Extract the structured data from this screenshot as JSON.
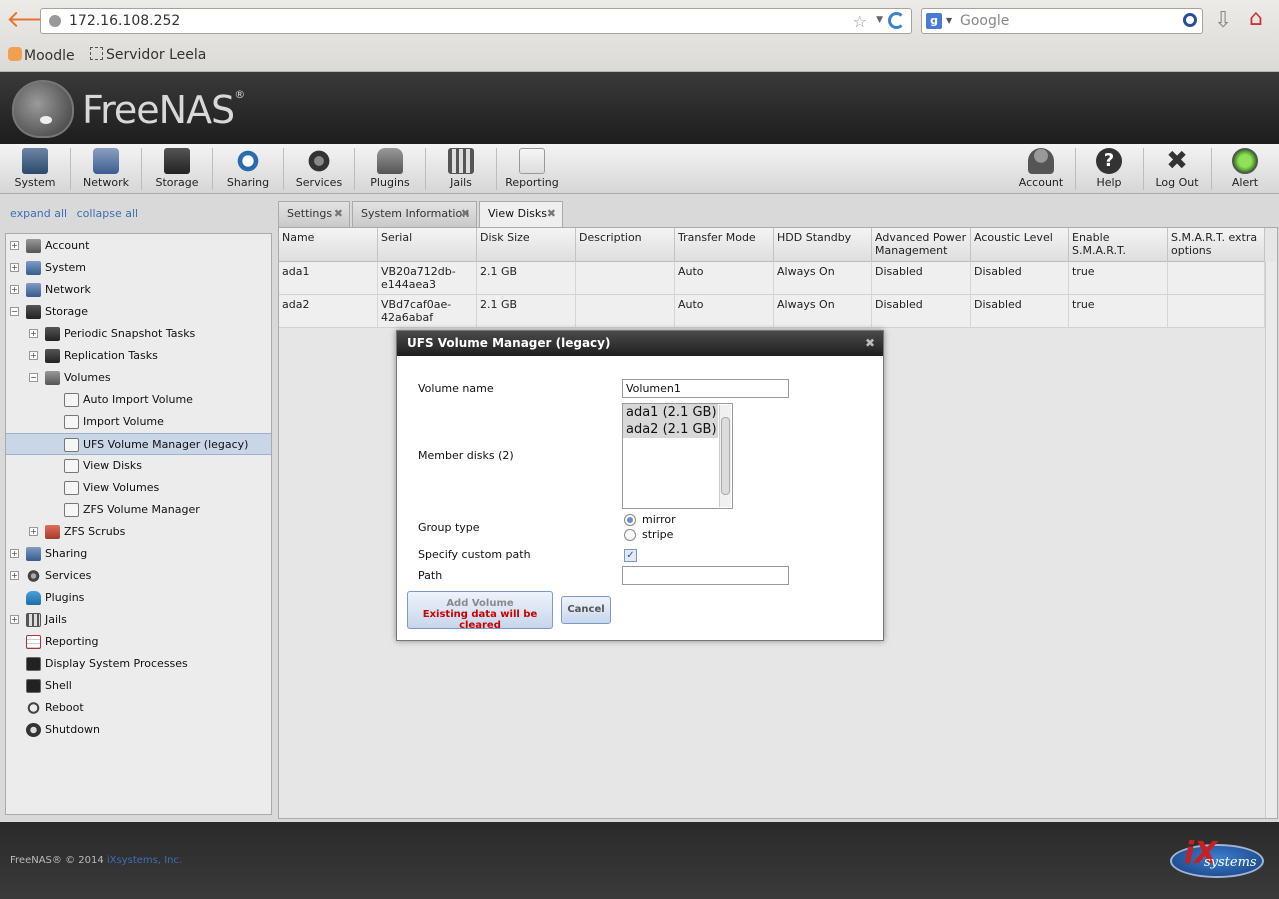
{
  "browser": {
    "url": "172.16.108.252",
    "search_placeholder": "Google",
    "bookmarks": [
      "Moodle",
      "Servidor Leela"
    ]
  },
  "brand": {
    "name": "FreeNAS",
    "reg": "®"
  },
  "toolbar": {
    "left": [
      {
        "label": "System",
        "icon": "system-icon"
      },
      {
        "label": "Network",
        "icon": "network-icon"
      },
      {
        "label": "Storage",
        "icon": "storage-icon"
      },
      {
        "label": "Sharing",
        "icon": "sharing-icon"
      },
      {
        "label": "Services",
        "icon": "services-icon"
      },
      {
        "label": "Plugins",
        "icon": "plugins-icon"
      },
      {
        "label": "Jails",
        "icon": "jails-icon"
      },
      {
        "label": "Reporting",
        "icon": "reporting-icon"
      }
    ],
    "right": [
      {
        "label": "Account",
        "icon": "account-icon"
      },
      {
        "label": "Help",
        "icon": "help-icon"
      },
      {
        "label": "Log Out",
        "icon": "logout-icon"
      },
      {
        "label": "Alert",
        "icon": "alert-icon"
      }
    ]
  },
  "sidebar": {
    "expand_all": "expand all",
    "collapse_all": "collapse all",
    "items": {
      "account": "Account",
      "system": "System",
      "network": "Network",
      "storage": "Storage",
      "periodic_snapshot": "Periodic Snapshot Tasks",
      "replication": "Replication Tasks",
      "volumes": "Volumes",
      "auto_import": "Auto Import Volume",
      "import_volume": "Import Volume",
      "ufs_manager": "UFS Volume Manager (legacy)",
      "view_disks": "View Disks",
      "view_volumes": "View Volumes",
      "zfs_manager": "ZFS Volume Manager",
      "zfs_scrubs": "ZFS Scrubs",
      "sharing": "Sharing",
      "services": "Services",
      "plugins": "Plugins",
      "jails": "Jails",
      "reporting": "Reporting",
      "processes": "Display System Processes",
      "shell": "Shell",
      "reboot": "Reboot",
      "shutdown": "Shutdown"
    }
  },
  "tabs": {
    "settings": "Settings",
    "system_info": "System Information",
    "view_disks": "View Disks",
    "close_glyph": "✖"
  },
  "grid": {
    "columns": [
      "Name",
      "Serial",
      "Disk Size",
      "Description",
      "Transfer Mode",
      "HDD Standby",
      "Advanced Power Management",
      "Acoustic Level",
      "Enable S.M.A.R.T.",
      "S.M.A.R.T. extra options"
    ],
    "rows": [
      [
        "ada1",
        "VB20a712db-e144aea3",
        "2.1 GB",
        "",
        "Auto",
        "Always On",
        "Disabled",
        "Disabled",
        "true",
        ""
      ],
      [
        "ada2",
        "VBd7caf0ae-42a6abaf",
        "2.1 GB",
        "",
        "Auto",
        "Always On",
        "Disabled",
        "Disabled",
        "true",
        ""
      ]
    ]
  },
  "dialog": {
    "title": "UFS Volume Manager (legacy)",
    "close_glyph": "✖",
    "volume_name_label": "Volume name",
    "volume_name_value": "Volumen1",
    "member_disks_label": "Member disks (2)",
    "member_disks": [
      "ada1 (2.1 GB)",
      "ada2 (2.1 GB)"
    ],
    "group_type_label": "Group type",
    "group_types": [
      "mirror",
      "stripe"
    ],
    "group_type_selected": "mirror",
    "custom_path_label": "Specify custom path",
    "custom_path_checked": true,
    "path_label": "Path",
    "path_value": "",
    "add_button": "Add Volume",
    "add_warning": "Existing data will be cleared",
    "cancel_button": "Cancel"
  },
  "footer": {
    "copyright": "FreeNAS® © 2014 ",
    "company": "iXsystems, Inc.",
    "partner_logo_text": "systems"
  }
}
